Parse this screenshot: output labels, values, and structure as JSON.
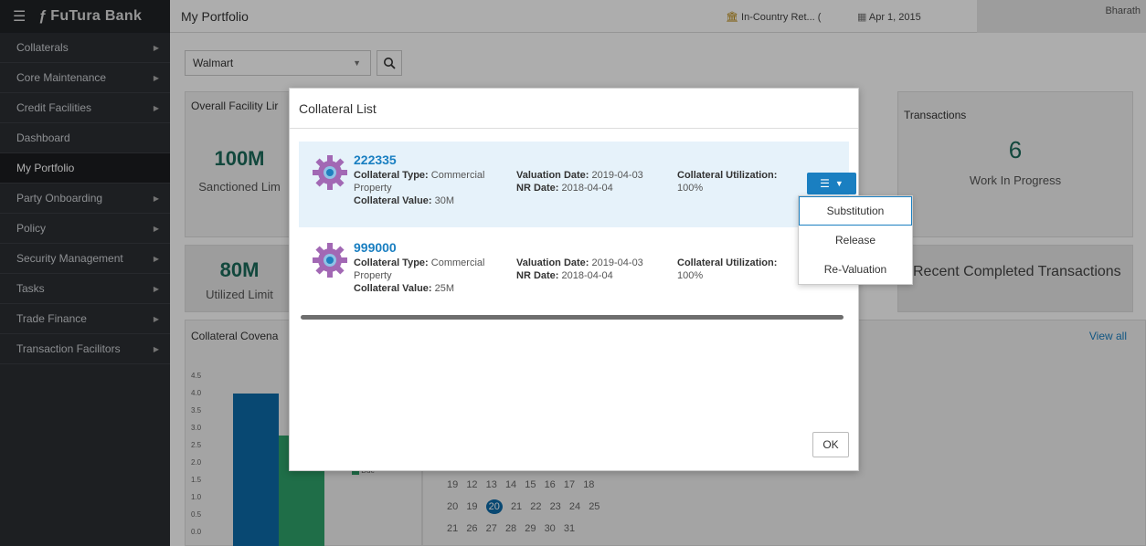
{
  "brand": {
    "name": "FuTura Bank"
  },
  "sidebar": {
    "items": [
      {
        "label": "Collaterals",
        "arrow": "▶"
      },
      {
        "label": "Core Maintenance",
        "arrow": "▶"
      },
      {
        "label": "Credit Facilities",
        "arrow": "▶"
      },
      {
        "label": "Dashboard",
        "arrow": ""
      },
      {
        "label": "My Portfolio",
        "arrow": ""
      },
      {
        "label": "Party Onboarding",
        "arrow": "▶"
      },
      {
        "label": "Policy",
        "arrow": "▶"
      },
      {
        "label": "Security Management",
        "arrow": "▶"
      },
      {
        "label": "Tasks",
        "arrow": "▶"
      },
      {
        "label": "Trade Finance",
        "arrow": "▶"
      },
      {
        "label": "Transaction Facilitors",
        "arrow": "▶"
      }
    ]
  },
  "header": {
    "title": "My Portfolio",
    "entity": "In-Country Ret... (",
    "date": "Apr 1, 2015",
    "user": "Bharath"
  },
  "search": {
    "value": "Walmart"
  },
  "cards": {
    "overall_facility": "Overall Facility Lir",
    "sanctioned_value": "100M",
    "sanctioned_label": "Sanctioned Lim",
    "utilized_value": "80M",
    "utilized_label": "Utilized Limit",
    "covenant": "Collateral Covena",
    "transactions": "Transactions",
    "wip_count": "6",
    "wip_label": "Work In Progress",
    "recent": "Recent Completed Transactions",
    "view_all": "View all"
  },
  "bg_chart": {
    "y_ticks": [
      "4.5",
      "4.0",
      "3.5",
      "3.0",
      "2.5",
      "2.0",
      "1.5",
      "1.0",
      "0.5",
      "0.0"
    ],
    "legend_due": "Due"
  },
  "calendar": {
    "row1": [
      "19",
      "12",
      "13",
      "14",
      "15",
      "16",
      "17",
      "18"
    ],
    "row2": [
      "20",
      "19",
      "20",
      "21",
      "22",
      "23",
      "24",
      "25"
    ],
    "row3": [
      "21",
      "26",
      "27",
      "28",
      "29",
      "30",
      "31"
    ]
  },
  "modal": {
    "title": "Collateral List",
    "ok_label": "OK",
    "items": [
      {
        "id": "222335",
        "type_label": "Collateral Type:",
        "type_value": "Commercial",
        "type_value2": "Property",
        "value_label": "Collateral Value:",
        "value_value": "30M",
        "valuation_label": "Valuation Date:",
        "valuation_value": "2019-04-03",
        "nr_label": "NR Date:",
        "nr_value": "2018-04-04",
        "util_label": "Collateral Utilization:",
        "util_value": "100%"
      },
      {
        "id": "999000",
        "type_label": "Collateral Type:",
        "type_value": "Commercial",
        "type_value2": "Property",
        "value_label": "Collateral Value:",
        "value_value": "25M",
        "valuation_label": "Valuation Date:",
        "valuation_value": "2019-04-03",
        "nr_label": "NR Date:",
        "nr_value": "2018-04-04",
        "util_label": "Collateral Utilization:",
        "util_value": "100%"
      }
    ]
  },
  "dropdown": {
    "items": [
      "Substitution",
      "Release",
      "Re-Valuation"
    ]
  },
  "colors": {
    "accent": "#1a7fc1",
    "sidebar": "#2b2e33"
  }
}
